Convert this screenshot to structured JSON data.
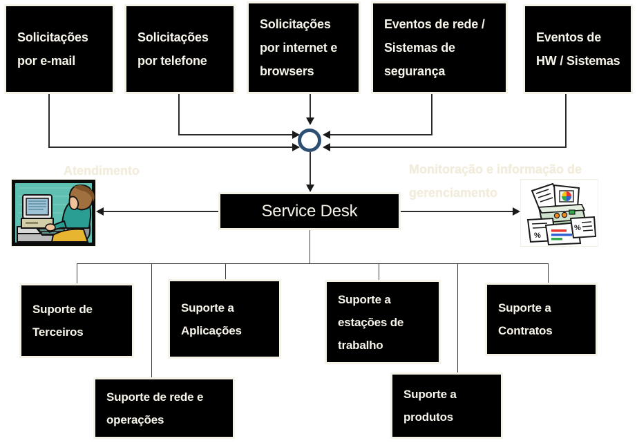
{
  "diagram": {
    "title": "Service Desk",
    "inputs": [
      {
        "id": "email",
        "lines": [
          "Solicitações",
          "por e-mail"
        ]
      },
      {
        "id": "telefone",
        "lines": [
          "Solicitações",
          "por telefone"
        ]
      },
      {
        "id": "internet",
        "lines": [
          "Solicitações",
          "por internet e",
          "browsers"
        ]
      },
      {
        "id": "rede",
        "lines": [
          "Eventos de rede /",
          "Sistemas de",
          "segurança"
        ]
      },
      {
        "id": "hw",
        "lines": [
          "Eventos de",
          "HW / Sistemas"
        ]
      }
    ],
    "hub": {
      "name": "junction-node",
      "color": "#2e4f74"
    },
    "center": {
      "label": "Service Desk"
    },
    "side_captions": {
      "left": [
        "Atendimento"
      ],
      "right": [
        "Monitoração e informação de",
        "gerenciamento"
      ]
    },
    "clipart": {
      "left": {
        "alt": "Pessoa em frente ao computador"
      },
      "right": {
        "alt": "Impressora com relatórios"
      }
    },
    "outputs_row1": [
      {
        "id": "terceiros",
        "lines": [
          "Suporte de",
          "Terceiros"
        ]
      },
      {
        "id": "aplicacoes",
        "lines": [
          "Suporte a",
          "Aplicações"
        ]
      },
      {
        "id": "estacoes",
        "lines": [
          "Suporte a",
          "estações de",
          "trabalho"
        ]
      },
      {
        "id": "contratos",
        "lines": [
          "Suporte a",
          "Contratos"
        ]
      }
    ],
    "outputs_row2": [
      {
        "id": "rede-operacoes",
        "lines": [
          "Suporte de rede e",
          "operações"
        ]
      },
      {
        "id": "produtos",
        "lines": [
          "Suporte a",
          "produtos"
        ]
      }
    ],
    "colors": {
      "box_fill": "#000000",
      "box_border": "#f5f2e7",
      "text": "#f7f4e9",
      "line": "#2b2b2b",
      "hub_ring": "#2e4f74",
      "faint_caption": "#f2ecdd"
    }
  }
}
